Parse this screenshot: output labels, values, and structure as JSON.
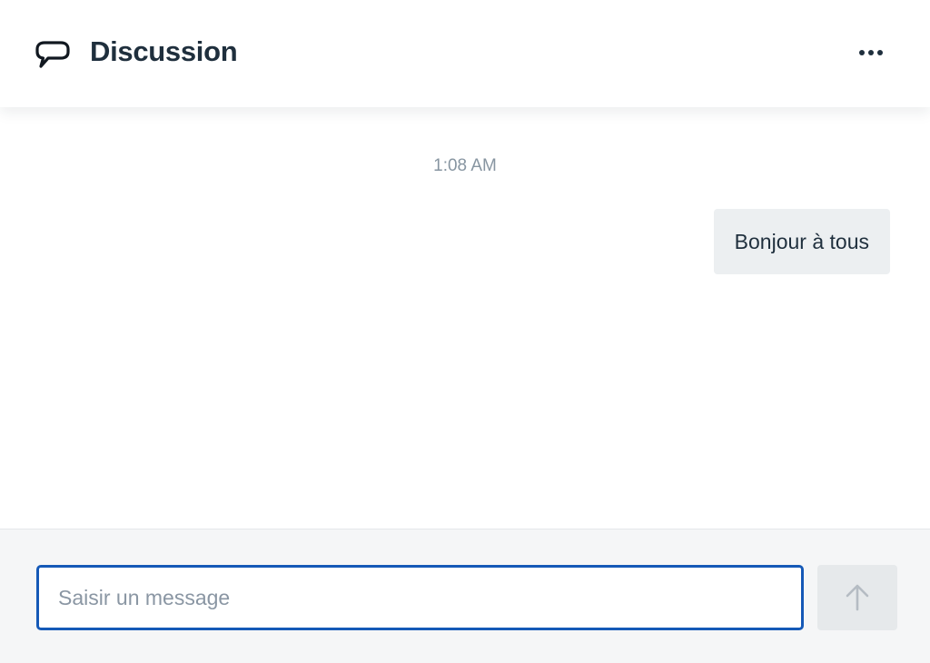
{
  "header": {
    "title": "Discussion",
    "icon": "speech-bubble-icon",
    "menu_icon": "more-horizontal-icon"
  },
  "messages": {
    "timestamp": "1:08 AM",
    "items": [
      {
        "text": "Bonjour à tous",
        "direction": "outgoing"
      }
    ]
  },
  "composer": {
    "placeholder": "Saisir un message",
    "value": "",
    "send_icon": "arrow-up-icon"
  },
  "colors": {
    "title_text": "#1f2f3d",
    "muted_text": "#8795a1",
    "bubble_bg": "#eceff1",
    "input_focus_border": "#1559b7",
    "composer_bg": "#f5f6f7",
    "send_button_bg": "#e6e9eb",
    "send_icon_disabled": "#b5bcc3"
  }
}
